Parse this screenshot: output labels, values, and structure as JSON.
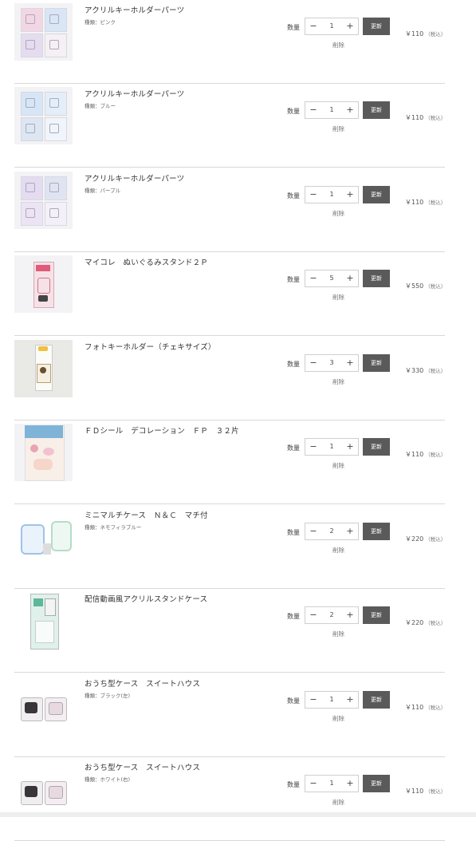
{
  "cart": {
    "qty_label": "数量",
    "update_label": "更新",
    "remove_label": "削除",
    "minus_symbol": "−",
    "plus_symbol": "+",
    "items": [
      {
        "name": "アクリルキーホルダーパーツ",
        "variant": "種類：ピンク",
        "qty": "1",
        "price": "￥110",
        "tax": "（税込）",
        "thumb": "acrylic-parts-pink"
      },
      {
        "name": "アクリルキーホルダーパーツ",
        "variant": "種類：ブルー",
        "qty": "1",
        "price": "￥110",
        "tax": "（税込）",
        "thumb": "acrylic-parts-blue"
      },
      {
        "name": "アクリルキーホルダーパーツ",
        "variant": "種類：パープル",
        "qty": "1",
        "price": "￥110",
        "tax": "（税込）",
        "thumb": "acrylic-parts-purple"
      },
      {
        "name": "マイコレ　ぬいぐるみスタンド２Ｐ",
        "variant": "",
        "qty": "5",
        "price": "￥550",
        "tax": "（税込）",
        "thumb": "plush-stand"
      },
      {
        "name": "フォトキーホルダー（チェキサイズ）",
        "variant": "",
        "qty": "3",
        "price": "￥330",
        "tax": "（税込）",
        "thumb": "photo-keyholder"
      },
      {
        "name": "ＦＤシール　デコレーション　ＦＰ　３２片",
        "variant": "",
        "qty": "1",
        "price": "￥110",
        "tax": "（税込）",
        "thumb": "fd-seal"
      },
      {
        "name": "ミニマルチケース　Ｎ＆Ｃ　マチ付",
        "variant": "種類：ネモフィラブルー",
        "qty": "2",
        "price": "￥220",
        "tax": "（税込）",
        "thumb": "mini-multi-case"
      },
      {
        "name": "配信動画風アクリルスタンドケース",
        "variant": "",
        "qty": "2",
        "price": "￥220",
        "tax": "（税込）",
        "thumb": "acrylic-stand-case"
      },
      {
        "name": "おうち型ケース　スイートハウス",
        "variant": "種類：ブラック(左)",
        "qty": "1",
        "price": "￥110",
        "tax": "（税込）",
        "thumb": "house-case-black"
      },
      {
        "name": "おうち型ケース　スイートハウス",
        "variant": "種類：ホワイト(右)",
        "qty": "1",
        "price": "￥110",
        "tax": "（税込）",
        "thumb": "house-case-white"
      }
    ]
  },
  "colors": {
    "update_button": "#5a5a5a",
    "divider": "#d8d8d8",
    "text": "#333333"
  }
}
